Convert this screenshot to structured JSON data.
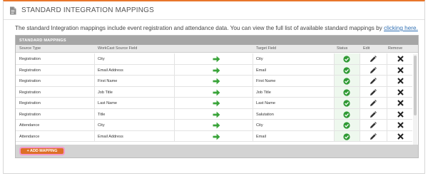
{
  "header": {
    "title": "STANDARD INTEGRATION MAPPINGS",
    "icon": "document-icon"
  },
  "description": {
    "text": "The standard Integration mappings include event registration and attendance data. You can view the full list of available standard mappings by ",
    "link": "clicking here."
  },
  "table": {
    "title": "STANDARD MAPPINGS",
    "columns": [
      "Source Type",
      "WorkCast Source Field",
      "Target Field",
      "Status",
      "Edit",
      "Remove"
    ],
    "rows": [
      {
        "source_type": "Registration",
        "source_field": "City",
        "target_field": "City"
      },
      {
        "source_type": "Registration",
        "source_field": "Email Address",
        "target_field": "Email"
      },
      {
        "source_type": "Registration",
        "source_field": "First Name",
        "target_field": "First Name"
      },
      {
        "source_type": "Registration",
        "source_field": "Job Title",
        "target_field": "Job Title"
      },
      {
        "source_type": "Registration",
        "source_field": "Last Name",
        "target_field": "Last Name"
      },
      {
        "source_type": "Registration",
        "source_field": "Title",
        "target_field": "Salutation"
      },
      {
        "source_type": "Attendance",
        "source_field": "City",
        "target_field": "City"
      },
      {
        "source_type": "Attendance",
        "source_field": "Email Address",
        "target_field": "Email"
      }
    ]
  },
  "actions": {
    "add_label": "+ ADD MAPPING"
  },
  "colors": {
    "accent": "#e8762b",
    "arrow": "#3aa43a",
    "status": "#2f9a34",
    "button": "#dd6f26"
  }
}
